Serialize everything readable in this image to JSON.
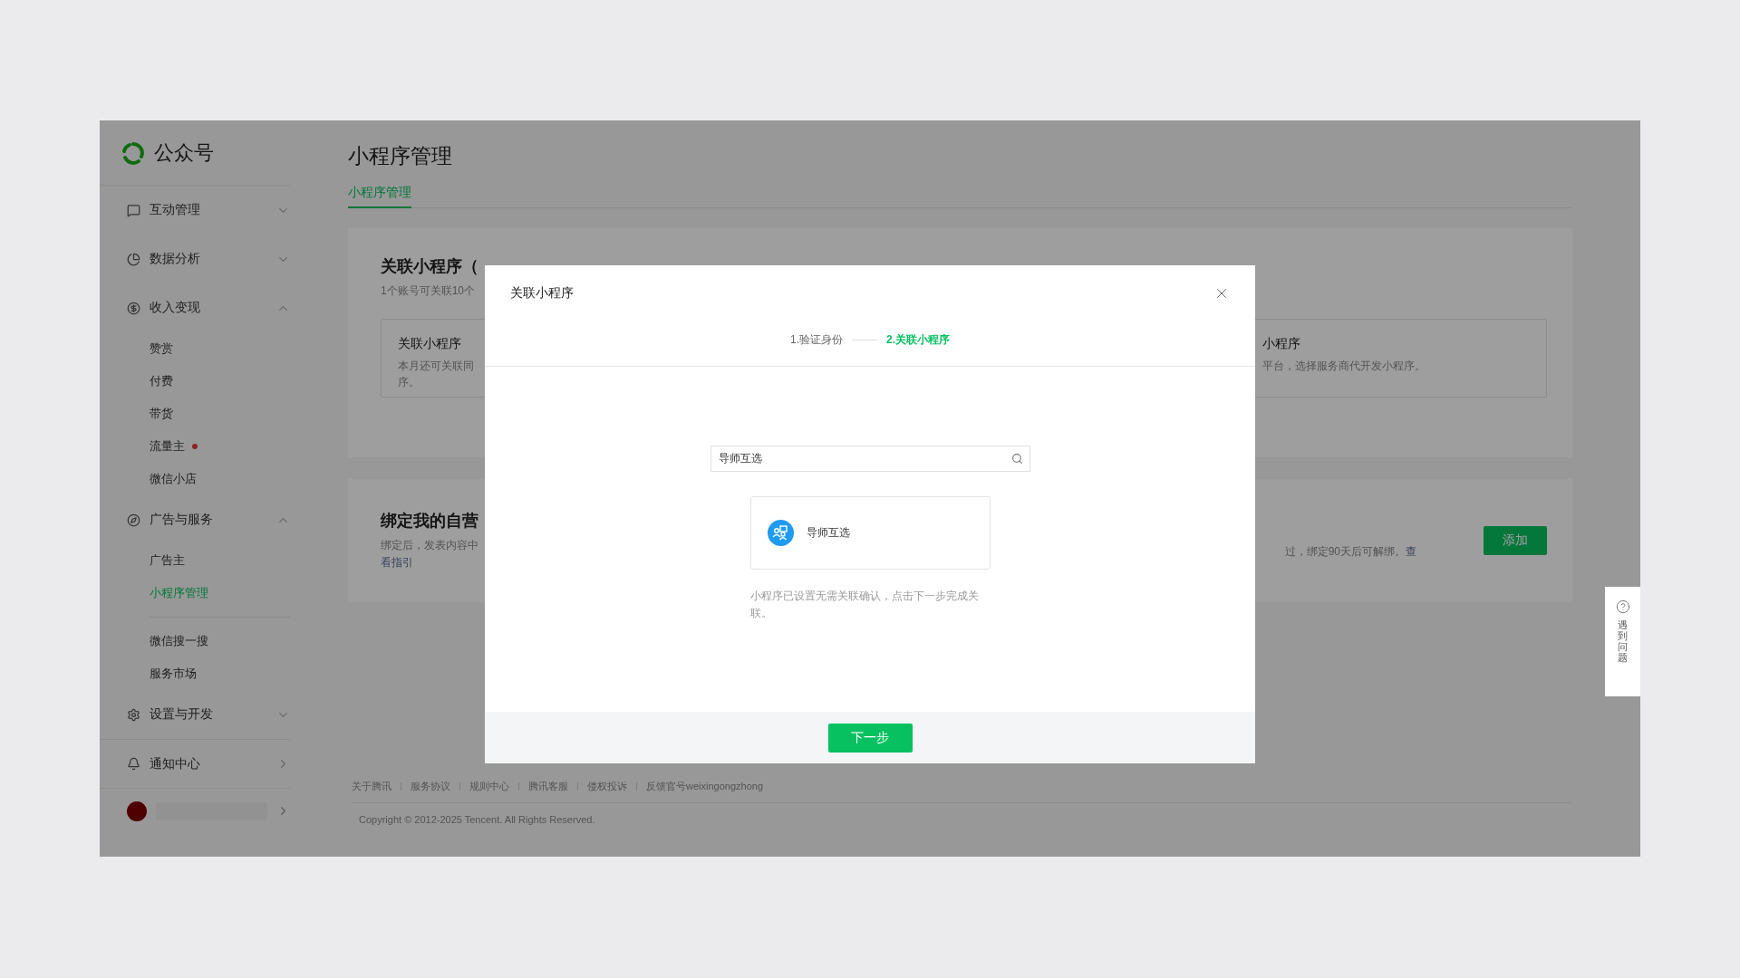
{
  "sidebar": {
    "logo_text": "公众号",
    "groups": [
      {
        "label": "互动管理",
        "kind": "group",
        "expanded": false
      },
      {
        "label": "数据分析",
        "kind": "group",
        "expanded": false
      },
      {
        "label": "收入变现",
        "kind": "group",
        "expanded": true,
        "children": [
          {
            "label": "赞赏",
            "selected": false,
            "has_dot": false,
            "divider_before": false
          },
          {
            "label": "付费",
            "selected": false,
            "has_dot": false,
            "divider_before": false
          },
          {
            "label": "带货",
            "selected": false,
            "has_dot": false,
            "divider_before": false
          },
          {
            "label": "流量主",
            "selected": false,
            "has_dot": true,
            "divider_before": false
          },
          {
            "label": "微信小店",
            "selected": false,
            "has_dot": false,
            "divider_before": false
          }
        ]
      },
      {
        "label": "广告与服务",
        "kind": "group",
        "expanded": true,
        "children": [
          {
            "label": "广告主",
            "selected": false,
            "has_dot": false,
            "divider_before": false
          },
          {
            "label": "小程序管理",
            "selected": true,
            "has_dot": false,
            "divider_before": false
          },
          {
            "label": "微信搜一搜",
            "selected": false,
            "has_dot": false,
            "divider_before": true
          },
          {
            "label": "服务市场",
            "selected": false,
            "has_dot": false,
            "divider_before": false
          }
        ]
      },
      {
        "label": "设置与开发",
        "kind": "group",
        "expanded": false
      },
      {
        "label": "通知中心",
        "kind": "link"
      },
      {
        "kind": "account"
      }
    ]
  },
  "page": {
    "title": "小程序管理",
    "tabs": [
      {
        "label": "小程序管理",
        "selected": true
      }
    ],
    "link_card": {
      "title": "关联小程序（",
      "subtitle": "1个账号可关联10个",
      "left_option": {
        "title": "关联小程序",
        "lines": [
          "本月还可关联同",
          "序。"
        ]
      },
      "right_option": {
        "title": "小程序",
        "lines": [
          "平台，选择服务商代开发小程序。"
        ]
      }
    },
    "bind_card": {
      "title": "绑定我的自营",
      "lines": [
        "绑定后，发表内容中"
      ],
      "left_link": "看指引",
      "right_text": "过，绑定90天后可解绑。",
      "right_link": "查",
      "button": "添加"
    },
    "footer": {
      "links": [
        "关于腾讯",
        "服务协议",
        "规则中心",
        "腾讯客服",
        "侵权投诉",
        "反馈官号weixingongzhong"
      ],
      "copyright": "Copyright © 2012-2025 Tencent. All Rights Reserved."
    }
  },
  "dialog": {
    "title": "关联小程序",
    "steps": [
      {
        "label": "1.验证身份",
        "selected": false
      },
      {
        "label": "2.关联小程序",
        "selected": true
      }
    ],
    "search": {
      "value": "导师互选"
    },
    "results": [
      {
        "name": "导师互选",
        "selected": false
      }
    ],
    "hint": "小程序已设置无需关联确认，点击下一步完成关联。",
    "button": "下一步"
  },
  "help_tab": {
    "label": "遇到问题"
  }
}
